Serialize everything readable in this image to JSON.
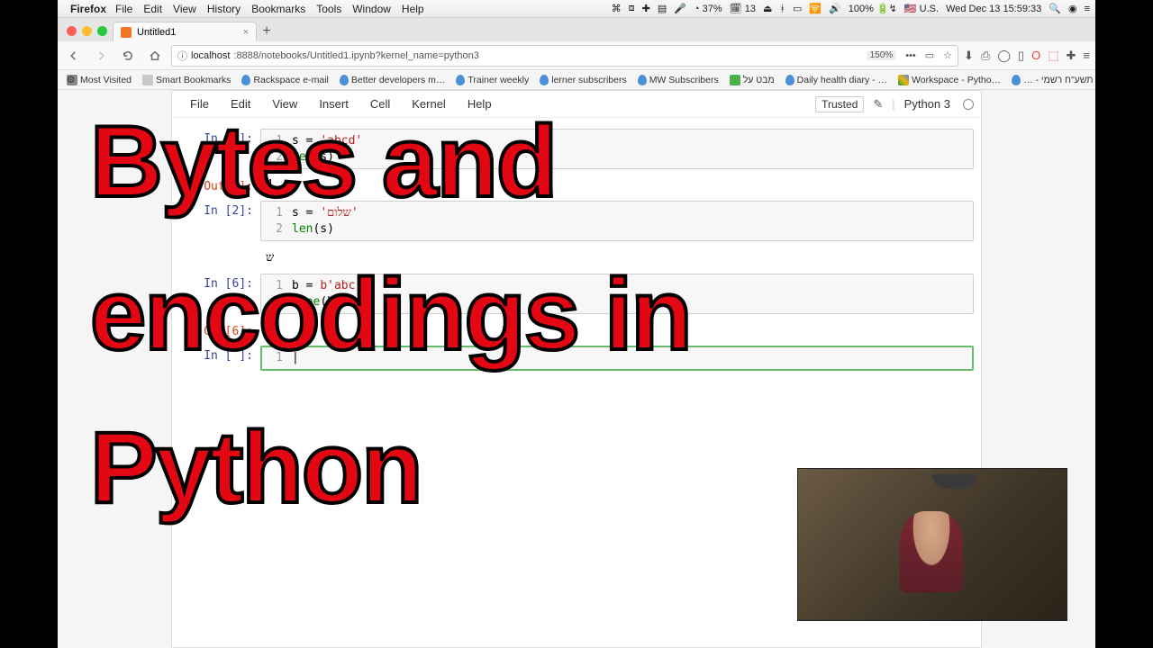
{
  "menubar": {
    "app": "Firefox",
    "items": [
      "File",
      "Edit",
      "View",
      "History",
      "Bookmarks",
      "Tools",
      "Window",
      "Help"
    ],
    "right": {
      "battery_pct": "37%",
      "charge": "100%",
      "flag": "U.S.",
      "datetime": "Wed Dec 13  15:59:33"
    }
  },
  "tab": {
    "title": "Untitled1"
  },
  "url": {
    "info_icon": "ⓘ",
    "host": "localhost",
    "rest": ":8888/notebooks/Untitled1.ipynb?kernel_name=python3",
    "zoom": "150%",
    "dots": "•••"
  },
  "bookmarks": [
    "Most Visited",
    "Smart Bookmarks",
    "Rackspace e-mail",
    "Better developers m…",
    "Trainer weekly",
    "lerner subscribers",
    "MW Subscribers",
    "מבט על",
    "Daily health diary - …",
    "Workspace - Pytho…",
    "… - נבאות תשע\"ח רשמי"
  ],
  "nb": {
    "menus": [
      "File",
      "Edit",
      "View",
      "Insert",
      "Cell",
      "Kernel",
      "Help"
    ],
    "trusted": "Trusted",
    "kernel": "Python 3",
    "cells": {
      "c1": {
        "in": "In [1]:",
        "l1": "s = 'abcd'",
        "l2": "len(s)",
        "out": "Out[1]:",
        "val": "4"
      },
      "c2": {
        "in": "In [2]:",
        "l1": "s = 'שלום'",
        "l2": "len(s)"
      },
      "c3": {
        "out": "ש"
      },
      "c6": {
        "in": "In [6]:",
        "l1": "b = b'abc'",
        "l2": "type(b)",
        "out": "Out[6]:"
      },
      "empty": {
        "in": "In [ ]:"
      }
    }
  },
  "title": {
    "l1": "Bytes and",
    "l2": "encodings in",
    "l3": "Python"
  }
}
